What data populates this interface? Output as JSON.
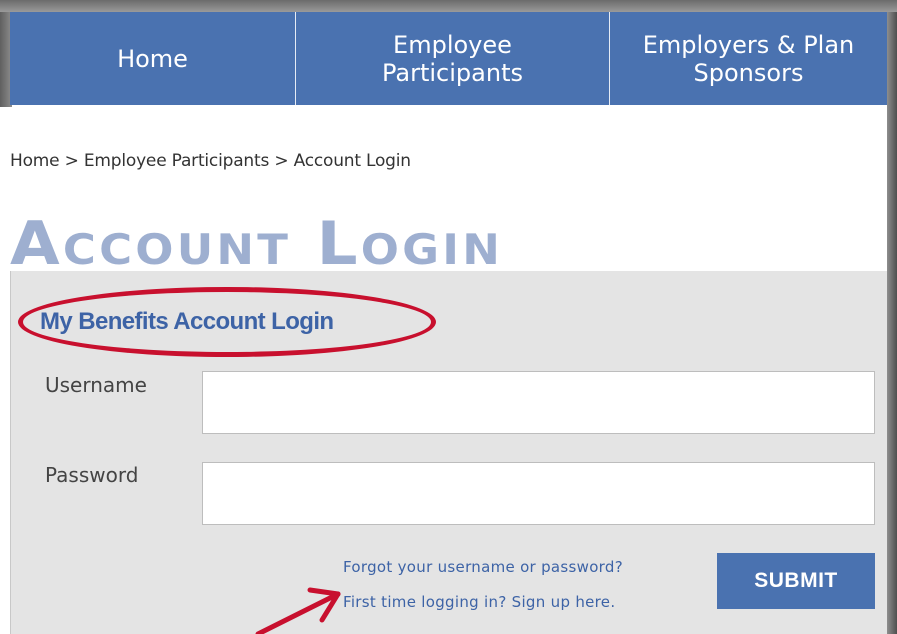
{
  "nav": {
    "items": [
      {
        "label": "Home"
      },
      {
        "label": "Employee\nParticipants"
      },
      {
        "label": "Employers & Plan\nSponsors"
      }
    ]
  },
  "breadcrumb": "Home > Employee Participants > Account Login",
  "page_title": "Account Login",
  "login": {
    "title": "My Benefits Account Login",
    "username_label": "Username",
    "username_value": "",
    "password_label": "Password",
    "password_value": "",
    "forgot_link": "Forgot your username or password?",
    "signup_link": "First time logging in? Sign up here.",
    "submit_label": "SUBMIT"
  },
  "colors": {
    "nav_blue": "#4a72b0",
    "title_light_blue": "#9eafd0",
    "link_blue": "#3d63a6",
    "panel_grey": "#e4e4e4",
    "annotation_red": "#c8102e"
  },
  "icons": {
    "annotation": [
      "ellipse-highlight-icon",
      "arrow-pointer-icon"
    ]
  }
}
